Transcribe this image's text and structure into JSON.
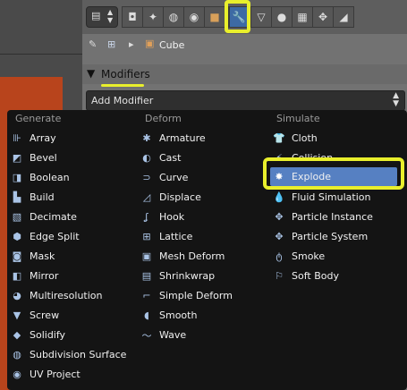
{
  "properties": {
    "breadcrumb": {
      "object_name": "Cube"
    },
    "section": {
      "title": "Modifiers"
    },
    "add_modifier": {
      "label": "Add Modifier"
    }
  },
  "menu": {
    "columns": [
      {
        "header": "Generate",
        "items": [
          {
            "label": "Array",
            "icon": "array-icon"
          },
          {
            "label": "Bevel",
            "icon": "bevel-icon"
          },
          {
            "label": "Boolean",
            "icon": "boolean-icon"
          },
          {
            "label": "Build",
            "icon": "build-icon"
          },
          {
            "label": "Decimate",
            "icon": "decimate-icon"
          },
          {
            "label": "Edge Split",
            "icon": "edge-split-icon"
          },
          {
            "label": "Mask",
            "icon": "mask-icon"
          },
          {
            "label": "Mirror",
            "icon": "mirror-icon"
          },
          {
            "label": "Multiresolution",
            "icon": "multires-icon"
          },
          {
            "label": "Screw",
            "icon": "screw-icon"
          },
          {
            "label": "Solidify",
            "icon": "solidify-icon"
          },
          {
            "label": "Subdivision Surface",
            "icon": "subsurf-icon"
          },
          {
            "label": "UV Project",
            "icon": "uv-project-icon"
          }
        ]
      },
      {
        "header": "Deform",
        "items": [
          {
            "label": "Armature",
            "icon": "armature-icon"
          },
          {
            "label": "Cast",
            "icon": "cast-icon"
          },
          {
            "label": "Curve",
            "icon": "curve-icon"
          },
          {
            "label": "Displace",
            "icon": "displace-icon"
          },
          {
            "label": "Hook",
            "icon": "hook-icon"
          },
          {
            "label": "Lattice",
            "icon": "lattice-icon"
          },
          {
            "label": "Mesh Deform",
            "icon": "mesh-deform-icon"
          },
          {
            "label": "Shrinkwrap",
            "icon": "shrinkwrap-icon"
          },
          {
            "label": "Simple Deform",
            "icon": "simple-deform-icon"
          },
          {
            "label": "Smooth",
            "icon": "smooth-icon"
          },
          {
            "label": "Wave",
            "icon": "wave-icon"
          }
        ]
      },
      {
        "header": "Simulate",
        "items": [
          {
            "label": "Cloth",
            "icon": "cloth-icon"
          },
          {
            "label": "Collision",
            "icon": "collision-icon"
          },
          {
            "label": "Explode",
            "icon": "explode-icon",
            "selected": true
          },
          {
            "label": "Fluid Simulation",
            "icon": "fluid-icon"
          },
          {
            "label": "Particle Instance",
            "icon": "particle-instance-icon"
          },
          {
            "label": "Particle System",
            "icon": "particle-system-icon"
          },
          {
            "label": "Smoke",
            "icon": "smoke-icon"
          },
          {
            "label": "Soft Body",
            "icon": "soft-body-icon"
          }
        ]
      }
    ]
  },
  "colors": {
    "accent_selected": "#5680c2",
    "annotation_highlight": "#e9ef2c",
    "menu_background": "#141414"
  }
}
